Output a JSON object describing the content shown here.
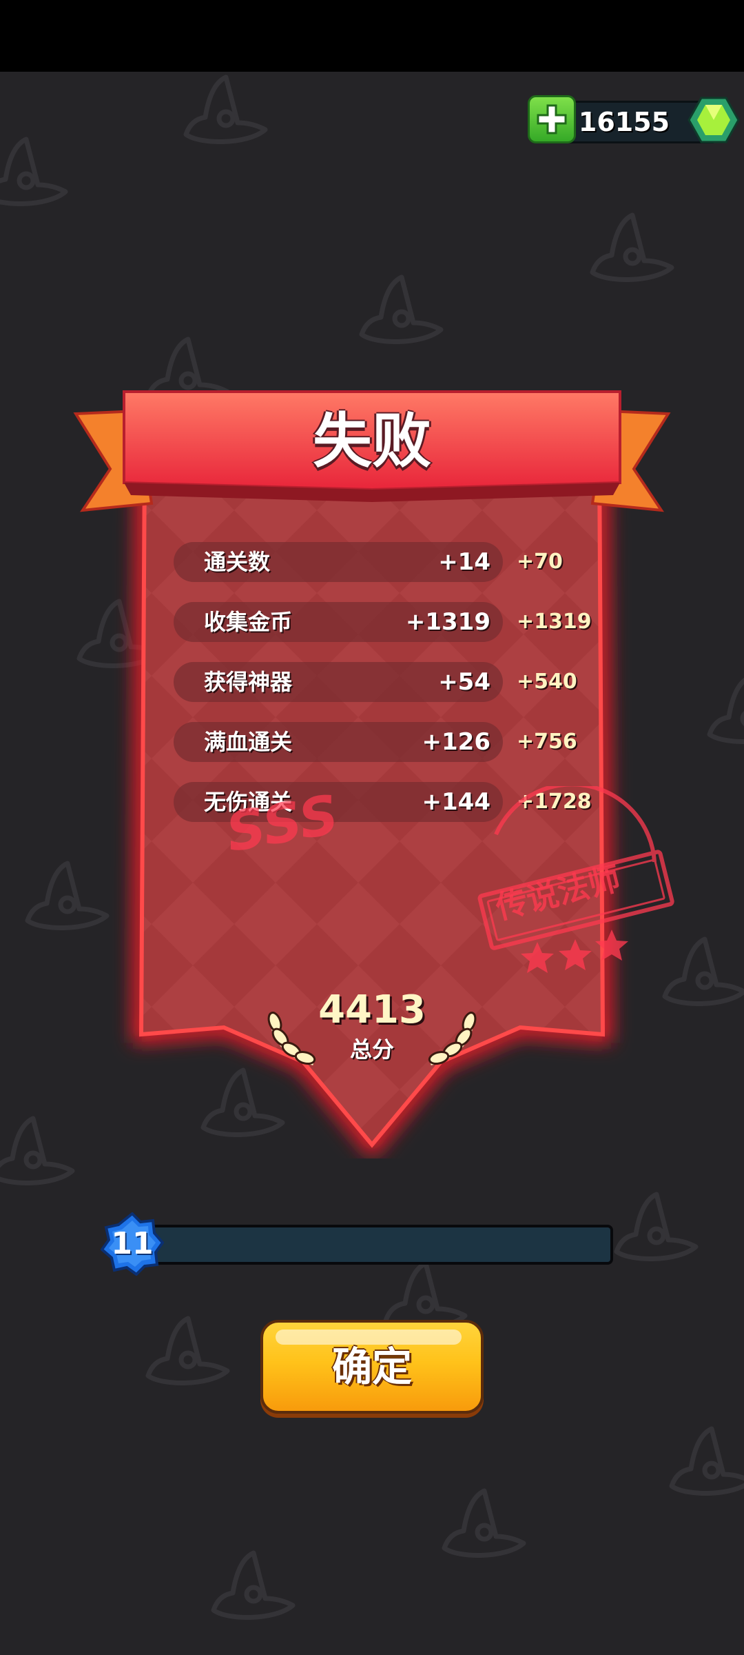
{
  "currency": {
    "amount": "16155",
    "plus_icon": "plus-icon",
    "gem_icon": "gem-icon",
    "accent_color": "#52c234"
  },
  "result": {
    "title": "失败",
    "banner_color": "#e8343f",
    "stats": [
      {
        "label": "通关数",
        "count": "+14",
        "points": "+70"
      },
      {
        "label": "收集金币",
        "count": "+1319",
        "points": "+1319"
      },
      {
        "label": "获得神器",
        "count": "+54",
        "points": "+540"
      },
      {
        "label": "满血通关",
        "count": "+126",
        "points": "+756"
      },
      {
        "label": "无伤通关",
        "count": "+144",
        "points": "+1728"
      }
    ],
    "rank_stamp": {
      "grade": "SSS",
      "label": "传说法师",
      "stars": 3
    },
    "total": {
      "value": "4413",
      "label": "总分"
    }
  },
  "level": {
    "value": "11",
    "progress": 0.0,
    "badge_color": "#1e73e8"
  },
  "confirm_button": {
    "label": "确定"
  },
  "background_icon": "wizard-hat-icon"
}
